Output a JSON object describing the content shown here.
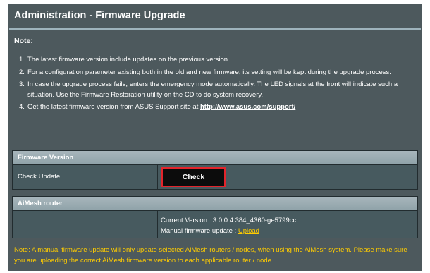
{
  "header": {
    "title": "Administration - Firmware Upgrade"
  },
  "note": {
    "label": "Note:",
    "items": [
      {
        "num": "1.",
        "text": "The latest firmware version include updates on the previous version."
      },
      {
        "num": "2.",
        "text": "For a configuration parameter existing both in the old and new firmware, its setting will be kept during the upgrade process."
      },
      {
        "num": "3.",
        "text": "In case the upgrade process fails, enters the emergency mode automatically. The LED signals at the front will indicate such a situation. Use the Firmware Restoration utility on the CD to do system recovery."
      },
      {
        "num": "4.",
        "text": "Get the latest firmware version from ASUS Support site at ",
        "link": "http://www.asus.com/support/"
      }
    ]
  },
  "firmware_version": {
    "header": "Firmware Version",
    "check_update_label": "Check Update",
    "check_button": "Check"
  },
  "aimesh": {
    "header": "AiMesh router",
    "current_version": "Current Version : 3.0.0.4.384_4360-ge5799cc",
    "manual_update_label": "Manual firmware update : ",
    "upload_link": "Upload"
  },
  "warning": "Note: A manual firmware update will only update selected AiMesh routers / nodes, when using the AiMesh system. Please make sure you are uploading the correct AiMesh firmware version to each applicable router / node.",
  "colors": {
    "panel_bg": "#4d595d",
    "table_header": "#9cadb3",
    "highlight_border": "#e3242b",
    "warning_text": "#ffcc00"
  }
}
